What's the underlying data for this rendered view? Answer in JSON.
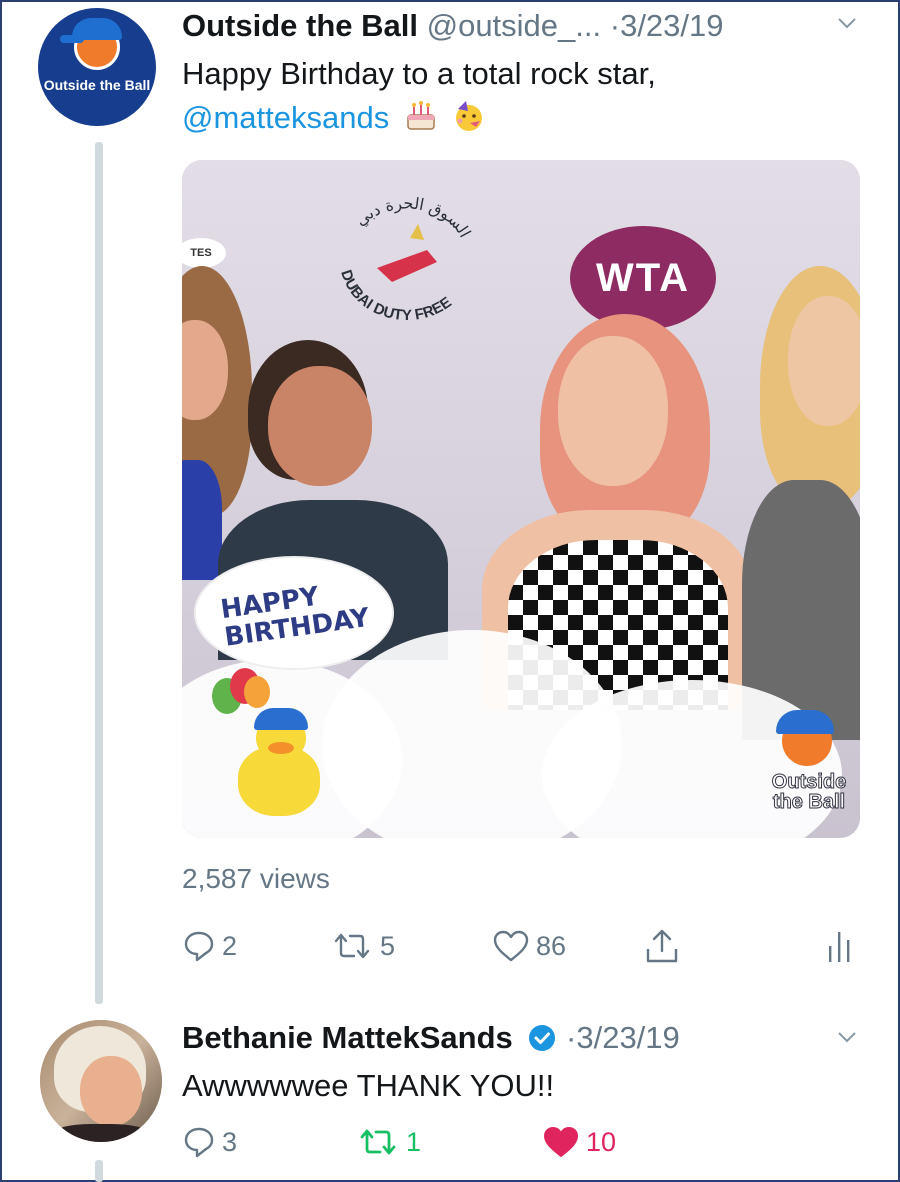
{
  "tweet1": {
    "author_name": "Outside the Ball",
    "handle": "@outside_...",
    "separator": "·",
    "date": "3/23/19",
    "avatar_text": "Outside the Ball",
    "text": "Happy Birthday to a total rock star,",
    "mention": "@matteksands",
    "emojis": [
      "birthday-cake-emoji",
      "partying-face-emoji"
    ],
    "media": {
      "sponsor_text": "DUBAI DUTY FREE",
      "sponsor_arabic": "السوق الحرة دبي",
      "wta_text": "WTA",
      "small_sign_text": "TES",
      "bubble_text_line1": "HAPPY",
      "bubble_text_line2": "BIRTHDAY",
      "watermark_line1": "Outside",
      "watermark_line2": "the Ball"
    },
    "views": "2,587 views",
    "actions": {
      "reply_count": "2",
      "retweet_count": "5",
      "like_count": "86"
    }
  },
  "tweet2": {
    "author_name": "Bethanie MattekSands",
    "separator": "·",
    "date": "3/23/19",
    "text": "Awwwwwee THANK YOU!!",
    "actions": {
      "reply_count": "3",
      "retweet_count": "1",
      "like_count": "10"
    }
  },
  "colors": {
    "primary_text": "#14171a",
    "secondary_text": "#657786",
    "mention_blue": "#1b95e0",
    "retweet_green": "#17bf63",
    "like_red": "#e0245e",
    "avatar_navy": "#173d8e",
    "thread_line": "#cfd9de"
  }
}
